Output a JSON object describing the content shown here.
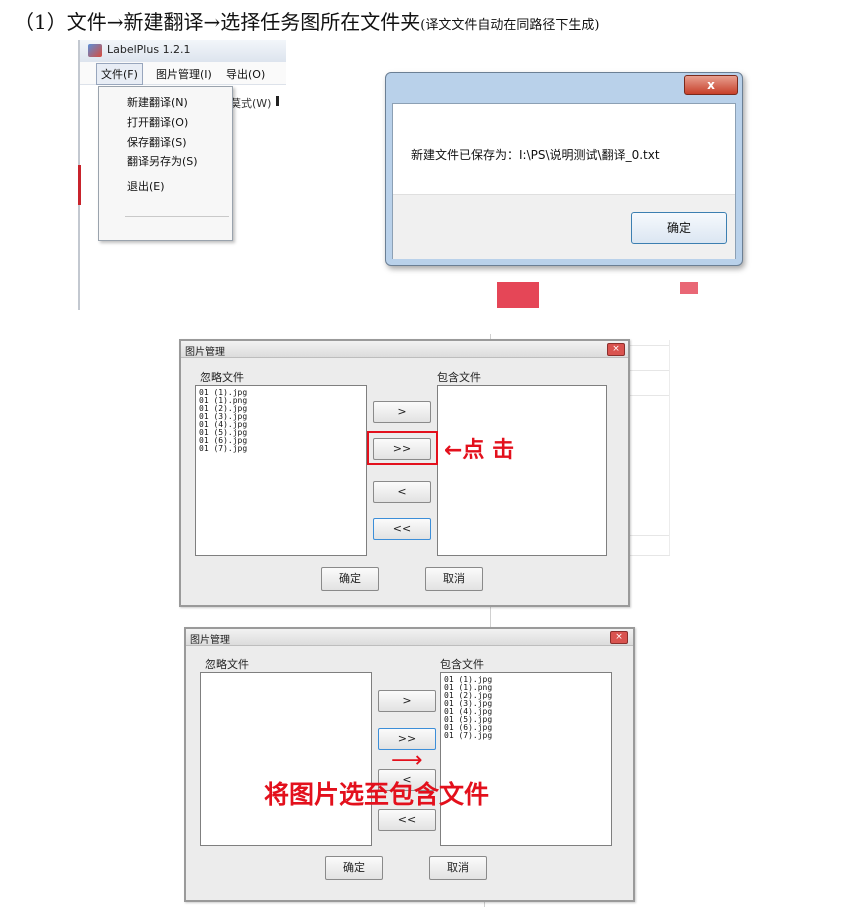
{
  "heading": {
    "main": "（1）文件→新建翻译→选择任务图所在文件夹",
    "note": "(译文文件自动在同路径下生成)"
  },
  "labelplus": {
    "title": "LabelPlus 1.2.1",
    "menubar": [
      "文件(F)",
      "图片管理(I)",
      "导出(O)"
    ],
    "menu_items": [
      "新建翻译(N)",
      "打开翻译(O)",
      "保存翻译(S)",
      "翻译另存为(S)",
      "退出(E)"
    ],
    "behind_text": "莫式(W)"
  },
  "save_dialog": {
    "close": "x",
    "message": "新建文件已保存为：I:\\PS\\说明测试\\翻译_0.txt",
    "ok": "确定"
  },
  "image_manager_a": {
    "title": "图片管理",
    "close": "×",
    "ignored_label": "忽略文件",
    "included_label": "包含文件",
    "ignored_files": [
      "01 (1).jpg",
      "01 (1).png",
      "01 (2).jpg",
      "01 (3).jpg",
      "01 (4).jpg",
      "01 (5).jpg",
      "01 (6).jpg",
      "01 (7).jpg"
    ],
    "included_files": [],
    "buttons": [
      ">",
      ">>",
      "<",
      "<<"
    ],
    "ok": "确定",
    "cancel": "取消",
    "annotation": "←点 击"
  },
  "image_manager_b": {
    "title": "图片管理",
    "close": "×",
    "ignored_label": "忽略文件",
    "included_label": "包含文件",
    "ignored_files": [],
    "included_files": [
      "01 (1).jpg",
      "01 (1).png",
      "01 (2).jpg",
      "01 (3).jpg",
      "01 (4).jpg",
      "01 (5).jpg",
      "01 (6).jpg",
      "01 (7).jpg"
    ],
    "buttons": [
      ">",
      ">>",
      "<",
      "<<"
    ],
    "ok": "确定",
    "cancel": "取消",
    "arrow": "⟶",
    "annotation": "将图片选至包含文件"
  },
  "colors": {
    "annotation_red": "#e3101c",
    "dialog_frame": "#b9d1ea",
    "close_red": "#c7402a"
  }
}
